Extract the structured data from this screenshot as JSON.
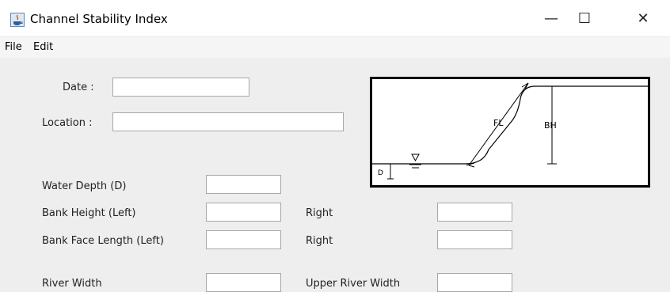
{
  "window": {
    "title": "Channel Stability Index",
    "minimize": "—",
    "maximize": "☐",
    "close": "✕"
  },
  "menu": [
    "File",
    "Edit"
  ],
  "form": {
    "date_label": "Date :",
    "date_value": "",
    "location_label": "Location :",
    "location_value": "",
    "water_depth_label": "Water Depth (D)",
    "water_depth_value": "",
    "bank_height_left_label": "Bank Height (Left)",
    "bank_height_left_value": "",
    "bank_height_right_label": "Right",
    "bank_height_right_value": "",
    "bank_face_left_label": "Bank Face Length (Left)",
    "bank_face_left_value": "",
    "bank_face_right_label": "Right",
    "bank_face_right_value": "",
    "river_width_label": "River Width",
    "river_width_value": "",
    "upper_river_width_label": "Upper River Width",
    "upper_river_width_value": ""
  },
  "diagram": {
    "fl_label": "FL",
    "bh_label": "BH",
    "d_label": "D"
  }
}
